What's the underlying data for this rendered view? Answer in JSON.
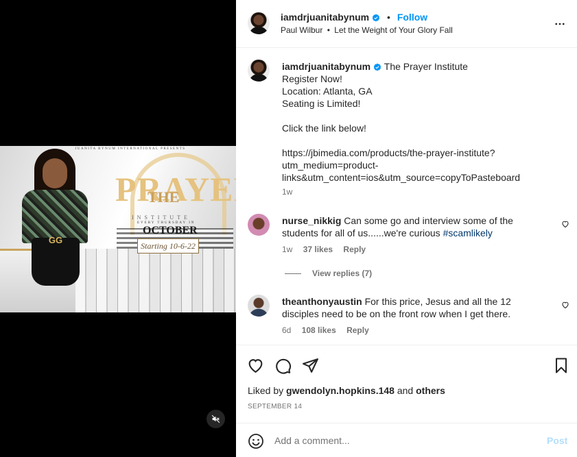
{
  "poster": {
    "presents": "JUANITA BYNUM INTERNATIONAL PRESENTS",
    "the": "THE",
    "title": "PRAYER",
    "institute": "INSTITUTE",
    "every": "EVERY THURSDAY IN",
    "month": "OCTOBER",
    "starting": "Starting 10-6-22",
    "belt": "GG"
  },
  "header": {
    "username": "iamdrjuanitabynum",
    "separator": "•",
    "follow_label": "Follow",
    "audio_artist": "Paul Wilbur",
    "audio_separator": "•",
    "audio_title": "Let the Weight of Your Glory Fall"
  },
  "caption": {
    "username": "iamdrjuanitabynum",
    "title": "The Prayer Institute",
    "lines": [
      "Register Now!",
      "Location: Atlanta, GA",
      "Seating is Limited!",
      "",
      "Click the link below!",
      "",
      "https://jbimedia.com/products/the-prayer-institute?",
      "utm_medium=product-",
      "links&utm_content=ios&utm_source=copyToPasteboard"
    ],
    "time": "1w"
  },
  "comments": [
    {
      "username": "nurse_nikkig",
      "text": "Can some go and interview some of the students for all of us......we're curious",
      "hashtag": "#scamlikely",
      "time": "1w",
      "likes": "37 likes",
      "reply": "Reply",
      "view_replies": "View replies (7)"
    },
    {
      "username": "theanthonyaustin",
      "text": "For this price, Jesus and all the 12 disciples need to be on the front row when I get there.",
      "time": "6d",
      "likes": "108 likes",
      "reply": "Reply"
    }
  ],
  "likes": {
    "prefix": "Liked by",
    "user": "gwendolyn.hopkins.148",
    "and": "and",
    "others": "others"
  },
  "date": "SEPTEMBER 14",
  "add_comment": {
    "placeholder": "Add a comment...",
    "post_label": "Post"
  },
  "colors": {
    "accent": "#0095f6",
    "hashtag": "#00376b",
    "secondary_text": "#737373",
    "post_disabled": "#b2dffc"
  }
}
